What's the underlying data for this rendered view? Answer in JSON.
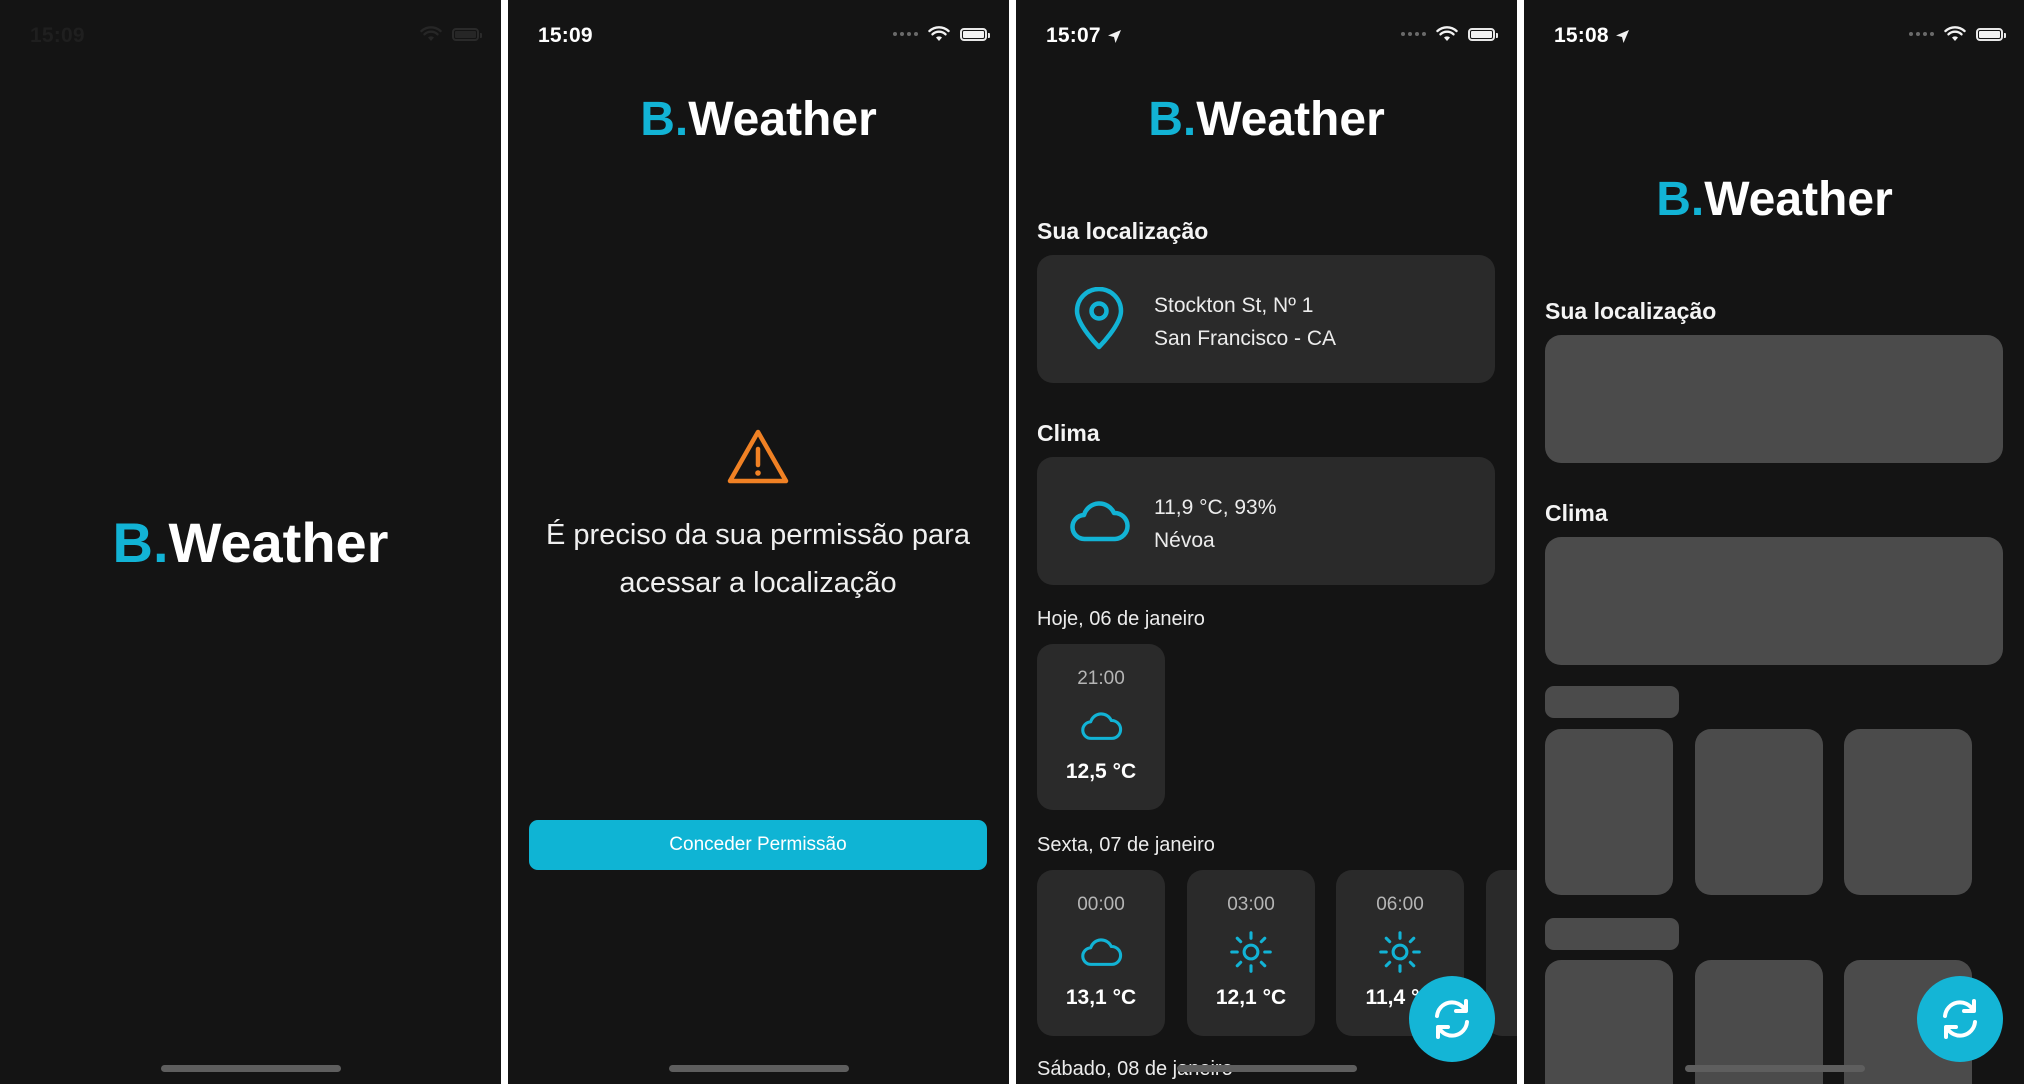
{
  "colors": {
    "accent": "#12b3d5",
    "warning": "#f08124",
    "background": "#141414",
    "card": "#2a2a2a",
    "skeleton": "#4b4b4b"
  },
  "logo": {
    "prefix": "B.",
    "name": "Weather"
  },
  "screens": [
    {
      "id": "splash",
      "status_time": "15:09"
    },
    {
      "id": "permission",
      "status_time": "15:09",
      "warning_icon": "warning-triangle-icon",
      "message": "É preciso da sua permissão para acessar a localização",
      "button_label": "Conceder Permissão"
    },
    {
      "id": "weather",
      "status_time": "15:07",
      "location_section": "Sua localização",
      "location_line1": "Stockton St, Nº 1",
      "location_line2": "San Francisco - CA",
      "weather_section": "Clima",
      "weather_line1": "11,9 °C, 93%",
      "weather_line2": "Névoa",
      "days": [
        {
          "label": "Hoje, 06 de janeiro",
          "hours": [
            {
              "time": "21:00",
              "icon": "cloud-icon",
              "temp": "12,5 °C"
            }
          ]
        },
        {
          "label": "Sexta, 07 de janeiro",
          "hours": [
            {
              "time": "00:00",
              "icon": "cloud-icon",
              "temp": "13,1 °C"
            },
            {
              "time": "03:00",
              "icon": "sun-icon",
              "temp": "12,1 °C"
            },
            {
              "time": "06:00",
              "icon": "sun-icon",
              "temp": "11,4 °C"
            }
          ]
        },
        {
          "label": "Sábado, 08 de janeiro",
          "hours": []
        }
      ],
      "refresh_icon": "refresh-icon"
    },
    {
      "id": "loading",
      "status_time": "15:08",
      "location_section": "Sua localização",
      "weather_section": "Clima",
      "refresh_icon": "refresh-icon"
    }
  ]
}
